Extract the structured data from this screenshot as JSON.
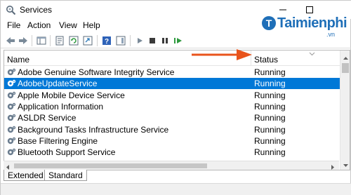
{
  "window": {
    "title": "Services",
    "app_icon": "gear-magnifier-icon"
  },
  "watermark": {
    "brand": "Taimienphi",
    "suffix": ".vn",
    "color": "#1f6fb8"
  },
  "menu": [
    {
      "label": "File"
    },
    {
      "label": "Action"
    },
    {
      "label": "View"
    },
    {
      "label": "Help"
    }
  ],
  "toolbar": {
    "icons": [
      "back-arrow-icon",
      "forward-arrow-icon",
      "console-tree-icon",
      "properties-icon",
      "refresh-icon",
      "export-list-icon",
      "help-icon",
      "show-hide-pane-icon",
      "play-icon",
      "stop-icon",
      "pause-icon",
      "restart-icon"
    ]
  },
  "list": {
    "columns": {
      "name": "Name",
      "status": "Status"
    },
    "rows": [
      {
        "name": "Adobe Genuine Software Integrity Service",
        "status": "Running",
        "selected": false
      },
      {
        "name": "AdobeUpdateService",
        "status": "Running",
        "selected": true
      },
      {
        "name": "Apple Mobile Device Service",
        "status": "Running",
        "selected": false
      },
      {
        "name": "Application Information",
        "status": "Running",
        "selected": false
      },
      {
        "name": "ASLDR Service",
        "status": "Running",
        "selected": false
      },
      {
        "name": "Background Tasks Infrastructure Service",
        "status": "Running",
        "selected": false
      },
      {
        "name": "Base Filtering Engine",
        "status": "Running",
        "selected": false
      },
      {
        "name": "Bluetooth Support Service",
        "status": "Running",
        "selected": false
      }
    ]
  },
  "tabs": [
    {
      "label": "Extended",
      "active": false
    },
    {
      "label": "Standard",
      "active": true
    }
  ],
  "colors": {
    "selection": "#0078d7",
    "arrow": "#e8541c"
  }
}
